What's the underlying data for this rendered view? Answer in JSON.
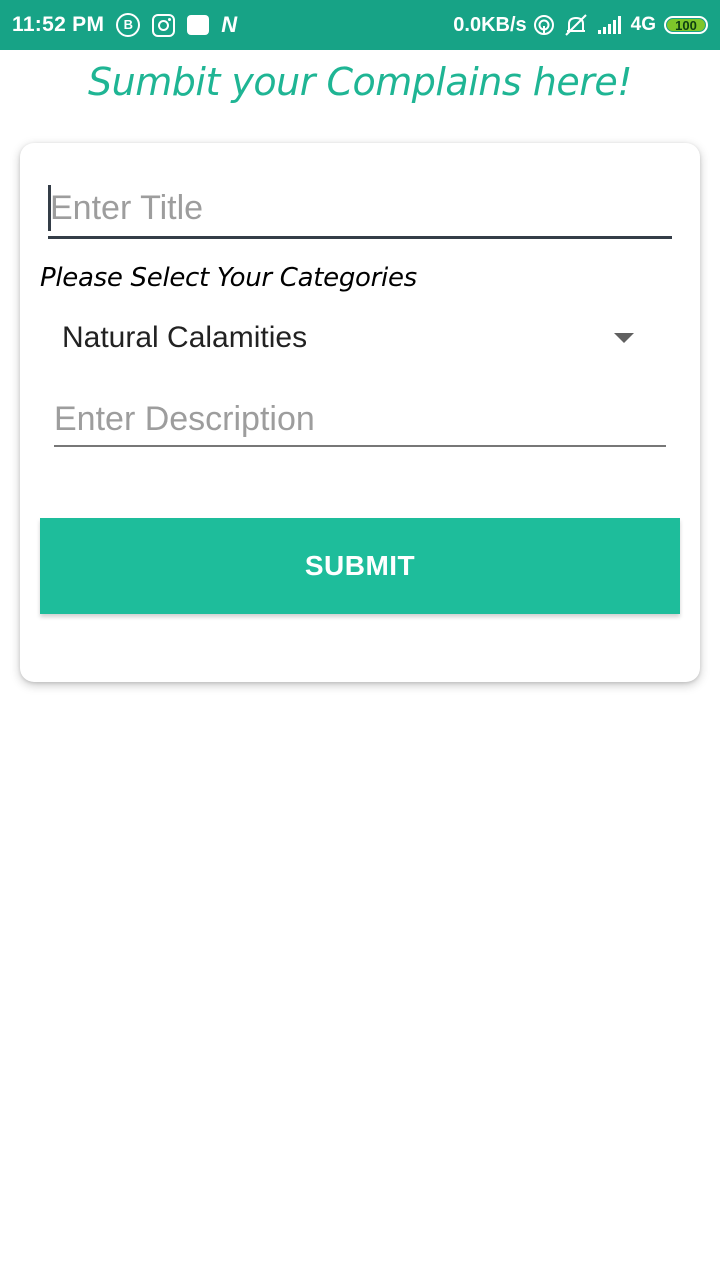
{
  "status_bar": {
    "time": "11:52 PM",
    "speed": "0.0KB/s",
    "network": "4G",
    "battery": "100",
    "left_icons": [
      "b-circle-icon",
      "instagram-icon",
      "notification-box-icon",
      "n-icon"
    ],
    "right_icons": [
      "hotspot-icon",
      "alarm-off-icon",
      "signal-icon"
    ]
  },
  "header": {
    "title": "Sumbit your Complains here!"
  },
  "form": {
    "title_placeholder": "Enter Title",
    "category_label": "Please Select Your Categories",
    "category_selected": "Natural Calamities",
    "description_placeholder": "Enter Description",
    "submit_label": "SUBMIT"
  },
  "colors": {
    "status_bar": "#17a386",
    "accent": "#1fb594",
    "button": "#1ebd9b",
    "battery": "#7ec62a"
  }
}
